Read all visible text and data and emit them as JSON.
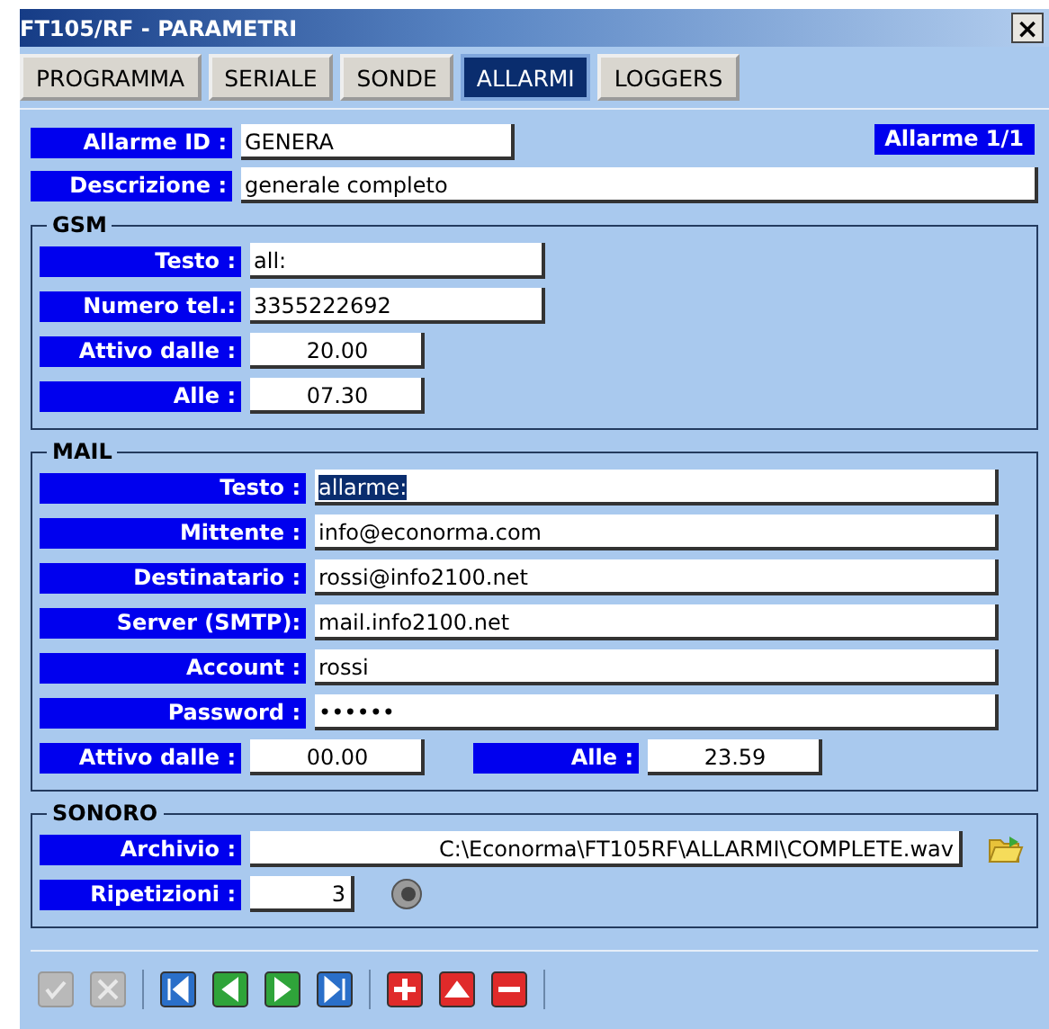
{
  "window": {
    "title": "FT105/RF - PARAMETRI",
    "close": "×"
  },
  "tabs": [
    {
      "label": "PROGRAMMA",
      "selected": false
    },
    {
      "label": "SERIALE",
      "selected": false
    },
    {
      "label": "SONDE",
      "selected": false
    },
    {
      "label": "ALLARMI",
      "selected": true
    },
    {
      "label": "LOGGERS",
      "selected": false
    }
  ],
  "header": {
    "id_label": "Allarme ID :",
    "id_value": "GENERA",
    "counter": "Allarme 1/1",
    "description_label": "Descrizione :",
    "description_value": "generale completo"
  },
  "gsm": {
    "title": "GSM",
    "fields": [
      {
        "label": "Testo :",
        "value": "all:",
        "kind": "text"
      },
      {
        "label": "Numero tel.:",
        "value": "3355222692",
        "kind": "text"
      },
      {
        "label": "Attivo dalle :",
        "value": "20.00",
        "kind": "time"
      },
      {
        "label": "Alle :",
        "value": "07.30",
        "kind": "time"
      }
    ]
  },
  "mail": {
    "title": "MAIL",
    "fields": [
      {
        "label": "Testo :",
        "value": "allarme:",
        "highlighted": true
      },
      {
        "label": "Mittente :",
        "value": "info@econorma.com",
        "highlighted": false
      },
      {
        "label": "Destinatario :",
        "value": "rossi@info2100.net",
        "highlighted": false
      },
      {
        "label": "Server (SMTP):",
        "value": "mail.info2100.net",
        "highlighted": false
      },
      {
        "label": "Account :",
        "value": "rossi",
        "highlighted": false
      },
      {
        "label": "Password :",
        "value": "••••••",
        "highlighted": false
      }
    ],
    "from_label": "Attivo dalle :",
    "from_value": "00.00",
    "to_label": "Alle :",
    "to_value": "23.59"
  },
  "sound": {
    "title": "SONORO",
    "file_label": "Archivio :",
    "file_value": "C:\\Econorma\\FT105RF\\ALLARMI\\COMPLETE.wav",
    "repeat_label": "Ripetizioni :",
    "repeat_value": "3"
  },
  "toolbar": [
    [
      {
        "kind": "confirm",
        "disabled": true
      },
      {
        "kind": "cancel",
        "disabled": true
      }
    ],
    [
      {
        "kind": "first",
        "disabled": false
      },
      {
        "kind": "previous",
        "disabled": false
      },
      {
        "kind": "next",
        "disabled": false
      },
      {
        "kind": "last",
        "disabled": false
      }
    ],
    [
      {
        "kind": "add",
        "disabled": false
      },
      {
        "kind": "up",
        "disabled": false
      },
      {
        "kind": "remove",
        "disabled": false
      }
    ]
  ]
}
